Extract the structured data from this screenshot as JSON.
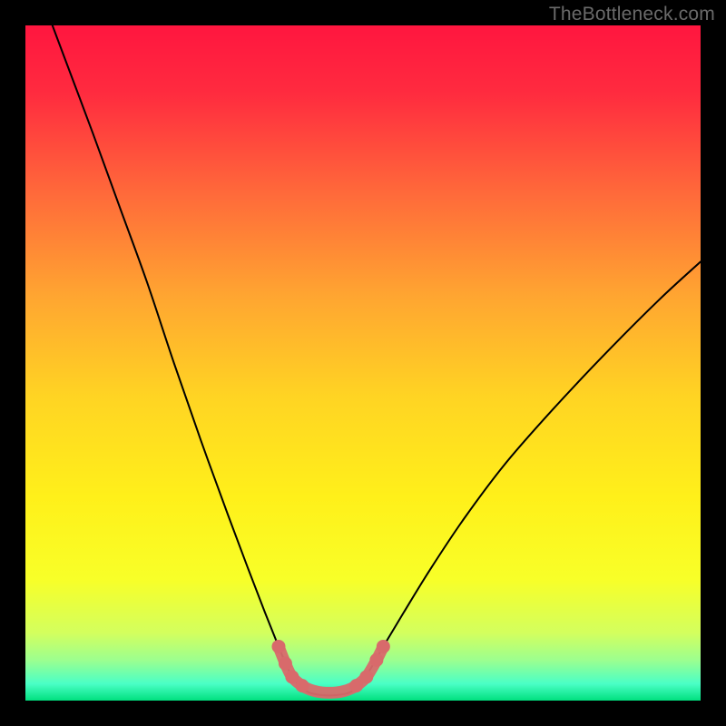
{
  "watermark": "TheBottleneck.com",
  "chart_data": {
    "type": "line",
    "title": "",
    "xlabel": "",
    "ylabel": "",
    "xlim": [
      0,
      100
    ],
    "ylim": [
      0,
      100
    ],
    "background_gradient": {
      "stops": [
        {
          "offset": 0.0,
          "color": "#ff163f"
        },
        {
          "offset": 0.1,
          "color": "#ff2b3f"
        },
        {
          "offset": 0.25,
          "color": "#ff6a3a"
        },
        {
          "offset": 0.4,
          "color": "#ffa531"
        },
        {
          "offset": 0.55,
          "color": "#ffd423"
        },
        {
          "offset": 0.7,
          "color": "#fff01a"
        },
        {
          "offset": 0.82,
          "color": "#f8ff28"
        },
        {
          "offset": 0.9,
          "color": "#d3ff5e"
        },
        {
          "offset": 0.94,
          "color": "#9cff8f"
        },
        {
          "offset": 0.975,
          "color": "#4affc6"
        },
        {
          "offset": 1.0,
          "color": "#00e07f"
        }
      ]
    },
    "series": [
      {
        "name": "bottleneck-curve",
        "color": "#000000",
        "points": [
          {
            "x": 4.0,
            "y": 100.0
          },
          {
            "x": 7.0,
            "y": 92.0
          },
          {
            "x": 10.0,
            "y": 84.0
          },
          {
            "x": 14.0,
            "y": 73.0
          },
          {
            "x": 18.0,
            "y": 62.0
          },
          {
            "x": 22.0,
            "y": 50.0
          },
          {
            "x": 26.0,
            "y": 38.5
          },
          {
            "x": 30.0,
            "y": 27.5
          },
          {
            "x": 33.0,
            "y": 19.5
          },
          {
            "x": 35.5,
            "y": 13.0
          },
          {
            "x": 37.5,
            "y": 8.0
          },
          {
            "x": 39.0,
            "y": 4.5
          },
          {
            "x": 40.5,
            "y": 2.3
          },
          {
            "x": 42.0,
            "y": 1.2
          },
          {
            "x": 44.0,
            "y": 0.8
          },
          {
            "x": 46.0,
            "y": 0.8
          },
          {
            "x": 48.0,
            "y": 1.2
          },
          {
            "x": 49.5,
            "y": 2.3
          },
          {
            "x": 51.0,
            "y": 4.5
          },
          {
            "x": 53.0,
            "y": 8.0
          },
          {
            "x": 56.0,
            "y": 13.0
          },
          {
            "x": 60.0,
            "y": 19.5
          },
          {
            "x": 65.0,
            "y": 27.0
          },
          {
            "x": 71.0,
            "y": 35.0
          },
          {
            "x": 78.0,
            "y": 43.0
          },
          {
            "x": 86.0,
            "y": 51.5
          },
          {
            "x": 94.0,
            "y": 59.5
          },
          {
            "x": 100.0,
            "y": 65.0
          }
        ]
      },
      {
        "name": "optimal-band",
        "color": "#d86a6b",
        "thick": true,
        "points": [
          {
            "x": 37.5,
            "y": 8.0
          },
          {
            "x": 38.5,
            "y": 5.5
          },
          {
            "x": 39.5,
            "y": 3.5
          },
          {
            "x": 41.0,
            "y": 2.2
          },
          {
            "x": 42.5,
            "y": 1.5
          },
          {
            "x": 44.0,
            "y": 1.2
          },
          {
            "x": 46.0,
            "y": 1.2
          },
          {
            "x": 47.5,
            "y": 1.5
          },
          {
            "x": 49.0,
            "y": 2.2
          },
          {
            "x": 50.5,
            "y": 3.5
          },
          {
            "x": 52.0,
            "y": 6.0
          },
          {
            "x": 53.0,
            "y": 8.0
          }
        ]
      }
    ]
  }
}
